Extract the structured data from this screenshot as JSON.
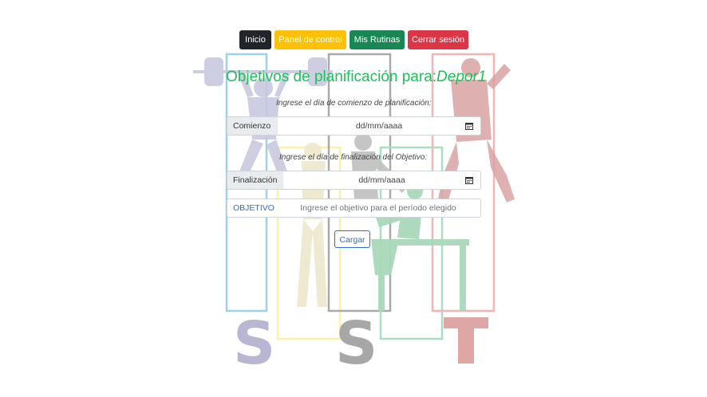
{
  "nav": {
    "home": "Inicio",
    "dashboard": "Panel de control",
    "routines": "Mis Rutinas",
    "logout": "Cerrar sesión"
  },
  "page": {
    "title": "Objetivos de planificación para:",
    "username": "Depor1"
  },
  "form": {
    "start_hint": "Ingrese el día de comienzo de planificación:",
    "start_label": "Comienzo",
    "start_value": "dd/mm/aaaa",
    "end_hint": "Ingrese el día de finalización del Objetivo:",
    "end_label": "Finalización",
    "end_value": "dd/mm/aaaa",
    "objective_label": "OBJETIVO",
    "objective_placeholder": "Ingrese el objetivo para el período elegido",
    "submit_label": "Cargar"
  },
  "icons": {
    "date_picker": "calendar-icon",
    "background": "sports-silhouettes-logo"
  },
  "colors": {
    "title": "#20c05a",
    "dark": "#212529",
    "yellow": "#ffc107",
    "green": "#198754",
    "red": "#dc3545",
    "link": "#2c6fd1"
  }
}
